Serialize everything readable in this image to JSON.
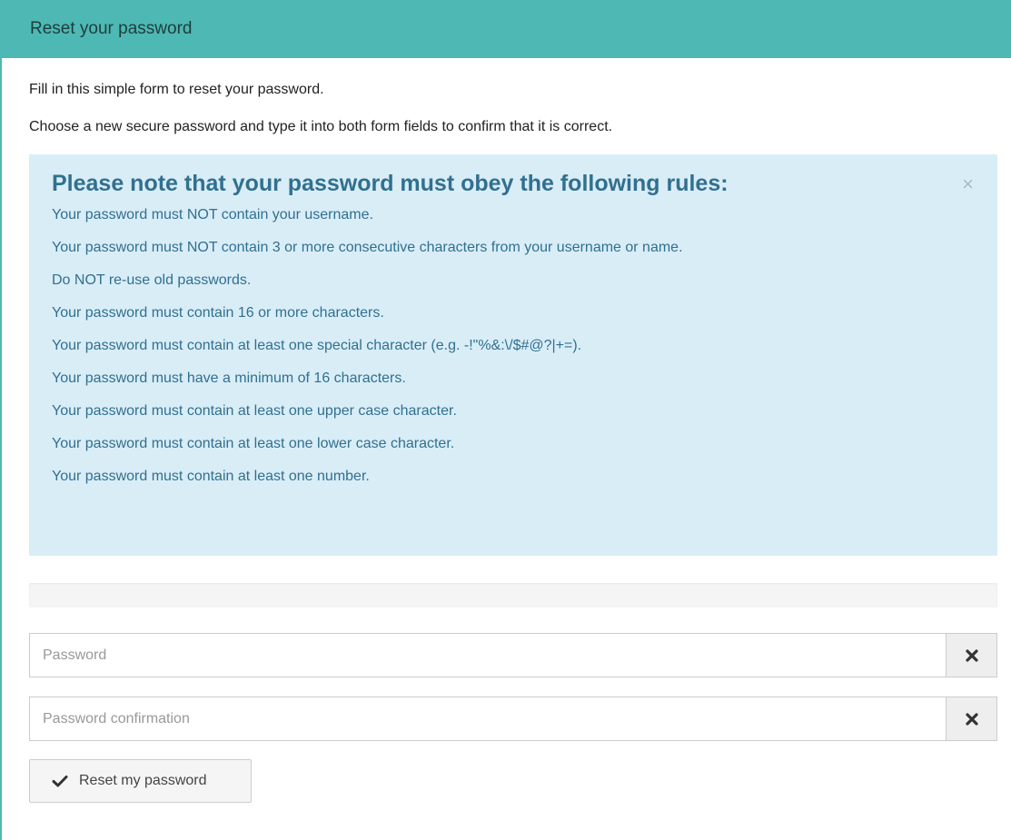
{
  "panel": {
    "title": "Reset your password"
  },
  "intro": {
    "line1": "Fill in this simple form to reset your password.",
    "line2": "Choose a new secure password and type it into both form fields to confirm that it is correct."
  },
  "rules_alert": {
    "title": "Please note that your password must obey the following rules:",
    "close_symbol": "×",
    "rules": [
      "Your password must NOT contain your username.",
      "Your password must NOT contain 3 or more consecutive characters from your username or name.",
      "Do NOT re-use old passwords.",
      "Your password must contain 16 or more characters.",
      "Your password must contain at least one special character (e.g. -!\"%&:\\/$#@?|+=).",
      "Your password must have a minimum of 16 characters.",
      "Your password must contain at least one upper case character.",
      "Your password must contain at least one lower case character.",
      "Your password must contain at least one number."
    ]
  },
  "strength_meter": {
    "progress": 0
  },
  "form": {
    "password": {
      "value": "",
      "placeholder": "Password",
      "clear_icon": "times-icon"
    },
    "password_confirmation": {
      "value": "",
      "placeholder": "Password confirmation",
      "clear_icon": "times-icon"
    },
    "submit": {
      "label": "Reset my password",
      "icon": "check-icon"
    }
  },
  "colors": {
    "header_bg": "#4db8b4",
    "alert_bg": "#d9edf7",
    "alert_text": "#31708f"
  }
}
